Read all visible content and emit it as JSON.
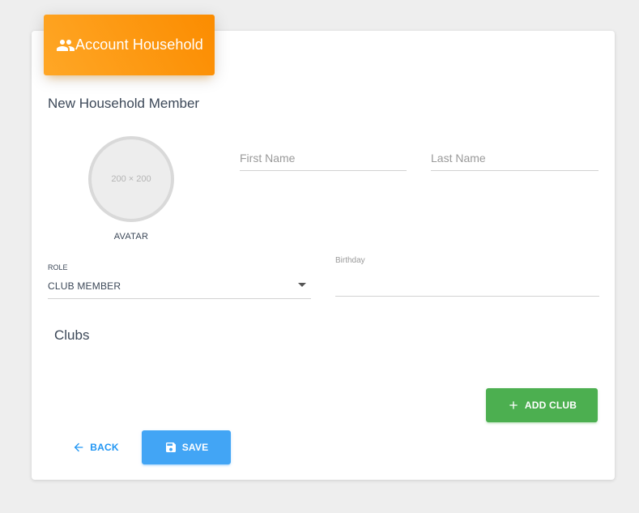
{
  "header": {
    "icon": "people-icon",
    "title": "Account Household",
    "color": "#fb8c00"
  },
  "form": {
    "section_title": "New Household Member",
    "avatar": {
      "placeholder": "200 × 200",
      "label": "AVATAR"
    },
    "first_name": {
      "placeholder": "First Name",
      "value": ""
    },
    "last_name": {
      "placeholder": "Last Name",
      "value": ""
    },
    "role": {
      "label": "ROLE",
      "value": "CLUB MEMBER"
    },
    "birthday": {
      "label": "Birthday",
      "value": ""
    }
  },
  "clubs": {
    "title": "Clubs",
    "add_button": {
      "icon": "plus-icon",
      "label": "ADD CLUB",
      "color": "#4caf50"
    }
  },
  "actions": {
    "back": {
      "icon": "arrow-left-icon",
      "label": "BACK",
      "color": "#2196f3"
    },
    "save": {
      "icon": "save-icon",
      "label": "SAVE",
      "color": "#42a5f5"
    }
  }
}
